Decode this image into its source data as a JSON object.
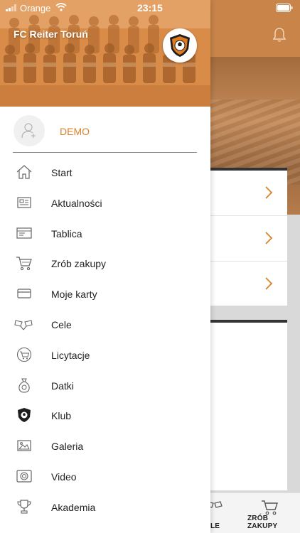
{
  "status_bar": {
    "carrier": "Orange",
    "time": "23:15"
  },
  "drawer": {
    "team_name": "FC Reiter Toruń",
    "user_name": "DEMO",
    "menu": [
      {
        "label": "Start",
        "icon": "home-icon"
      },
      {
        "label": "Aktualności",
        "icon": "news-icon"
      },
      {
        "label": "Tablica",
        "icon": "board-icon"
      },
      {
        "label": "Zrób zakupy",
        "icon": "cart-icon"
      },
      {
        "label": "Moje karty",
        "icon": "card-icon"
      },
      {
        "label": "Cele",
        "icon": "flags-icon"
      },
      {
        "label": "Licytacje",
        "icon": "auction-icon"
      },
      {
        "label": "Datki",
        "icon": "money-bag-icon"
      },
      {
        "label": "Klub",
        "icon": "club-icon"
      },
      {
        "label": "Galeria",
        "icon": "gallery-icon"
      },
      {
        "label": "Video",
        "icon": "video-icon"
      },
      {
        "label": "Akademia",
        "icon": "trophy-icon"
      }
    ]
  },
  "background": {
    "tabbar": {
      "cele_label": "LE",
      "shop_label": "ZRÓB ZAKUPY"
    }
  },
  "colors": {
    "accent": "#d9822b",
    "header": "#d98c47"
  }
}
